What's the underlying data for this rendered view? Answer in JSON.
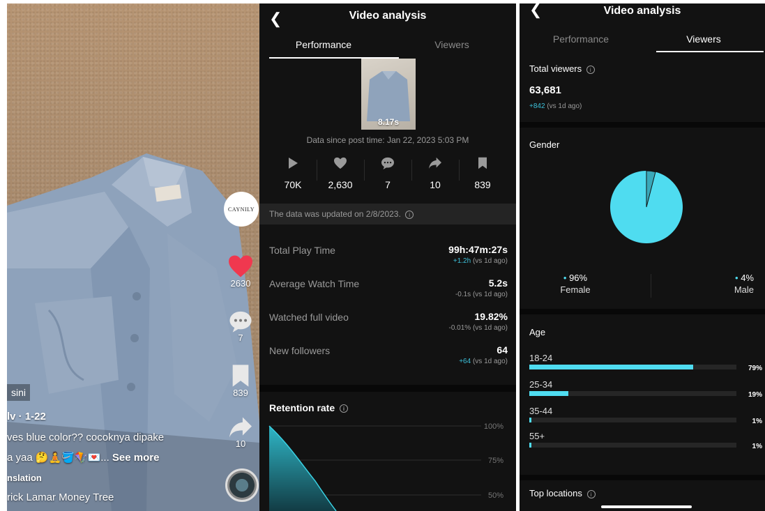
{
  "video": {
    "brand": "CAYNILY",
    "likes": "2630",
    "comments": "7",
    "saves": "839",
    "shares": "10",
    "left_badge": "sini",
    "author_line": "lv · 1-22",
    "caption_line1": "ves blue color?? cocoknya dipake",
    "caption_line2": "a yaa 🤔🧘🪣🪁💌...",
    "see_more": "See more",
    "translation": "nslation",
    "sound": "rick Lamar    Money Tree"
  },
  "performance": {
    "title": "Video analysis",
    "tabs": [
      "Performance",
      "Viewers"
    ],
    "duration": "8.17s",
    "since": "Data since post time: Jan 22, 2023 5:03 PM",
    "stats": [
      {
        "icon": "play-icon",
        "value": "70K"
      },
      {
        "icon": "heart-icon",
        "value": "2,630"
      },
      {
        "icon": "comment-icon",
        "value": "7"
      },
      {
        "icon": "share-icon",
        "value": "10"
      },
      {
        "icon": "bookmark-icon",
        "value": "839"
      }
    ],
    "updated": "The data was updated on 2/8/2023.",
    "metrics": [
      {
        "label": "Total Play Time",
        "value": "99h:47m:27s",
        "delta": "+1.2h",
        "suffix": "(vs 1d ago)"
      },
      {
        "label": "Average Watch Time",
        "value": "5.2s",
        "delta": "-0.1s",
        "suffix": "(vs 1d ago)"
      },
      {
        "label": "Watched full video",
        "value": "19.82%",
        "delta": "-0.01%",
        "suffix": "(vs 1d ago)"
      },
      {
        "label": "New followers",
        "value": "64",
        "delta": "+64",
        "suffix": "(vs 1d ago)"
      }
    ],
    "retention_title": "Retention rate",
    "retention_ticks": [
      "100%",
      "75%",
      "50%"
    ],
    "accent": "#3cc0d9"
  },
  "viewers": {
    "title": "Video analysis",
    "tabs": [
      "Performance",
      "Viewers"
    ],
    "total_label": "Total viewers",
    "total_value": "63,681",
    "total_delta": "+842",
    "total_suffix": "(vs 1d ago)",
    "gender_title": "Gender",
    "gender": [
      {
        "pct": "96%",
        "label": "Female",
        "value": 96
      },
      {
        "pct": "4%",
        "label": "Male",
        "value": 4
      }
    ],
    "age_title": "Age",
    "age": [
      {
        "label": "18-24",
        "pct": "79%",
        "value": 79
      },
      {
        "label": "25-34",
        "pct": "19%",
        "value": 19
      },
      {
        "label": "35-44",
        "pct": "1%",
        "value": 1
      },
      {
        "label": "55+",
        "pct": "1%",
        "value": 1
      }
    ],
    "locations_title": "Top locations",
    "accent": "#4fdcf0"
  }
}
